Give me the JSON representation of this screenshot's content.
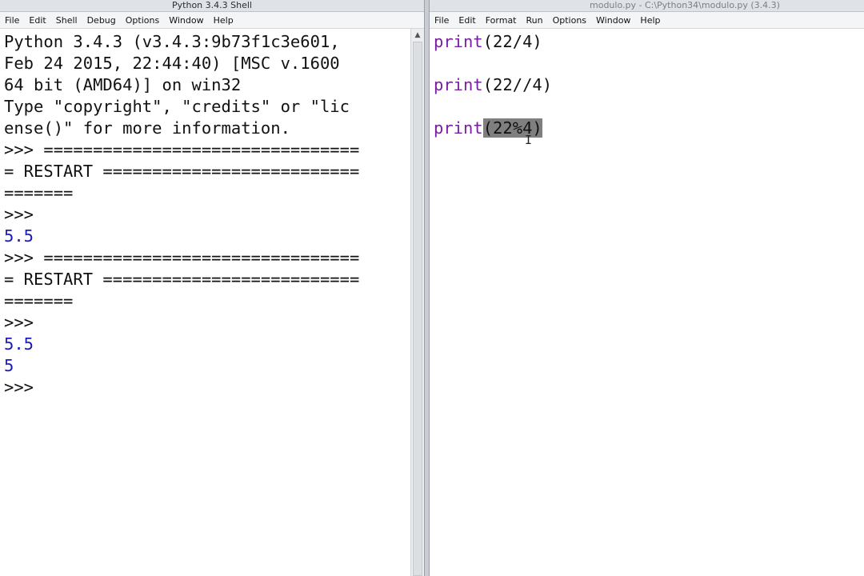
{
  "shell": {
    "title": "Python 3.4.3 Shell",
    "menu": [
      "File",
      "Edit",
      "Shell",
      "Debug",
      "Options",
      "Window",
      "Help"
    ],
    "lines": [
      {
        "text": "Python 3.4.3 (v3.4.3:9b73f1c3e601,",
        "kind": "normal"
      },
      {
        "text": "Feb 24 2015, 22:44:40) [MSC v.1600",
        "kind": "normal"
      },
      {
        "text": "64 bit (AMD64)] on win32",
        "kind": "normal"
      },
      {
        "text": "Type \"copyright\", \"credits\" or \"lic",
        "kind": "normal"
      },
      {
        "text": "ense()\" for more information.",
        "kind": "normal"
      },
      {
        "text": ">>> ================================",
        "kind": "normal"
      },
      {
        "text": "= RESTART ==========================",
        "kind": "normal"
      },
      {
        "text": "=======",
        "kind": "normal"
      },
      {
        "text": ">>>",
        "kind": "normal"
      },
      {
        "text": "5.5",
        "kind": "output"
      },
      {
        "text": ">>> ================================",
        "kind": "normal"
      },
      {
        "text": "= RESTART ==========================",
        "kind": "normal"
      },
      {
        "text": "=======",
        "kind": "normal"
      },
      {
        "text": ">>>",
        "kind": "normal"
      },
      {
        "text": "5.5",
        "kind": "output"
      },
      {
        "text": "5",
        "kind": "output"
      },
      {
        "text": ">>>",
        "kind": "normal"
      }
    ]
  },
  "editor": {
    "title": "modulo.py - C:\\Python34\\modulo.py (3.4.3)",
    "menu": [
      "File",
      "Edit",
      "Format",
      "Run",
      "Options",
      "Window",
      "Help"
    ],
    "lines": [
      {
        "keyword": "print",
        "rest": "(22/4)",
        "selected": ""
      },
      {
        "keyword": "",
        "rest": "",
        "selected": ""
      },
      {
        "keyword": "print",
        "rest": "(22//4)",
        "selected": ""
      },
      {
        "keyword": "",
        "rest": "",
        "selected": ""
      },
      {
        "keyword": "print",
        "rest": "",
        "selected": "(22%4)"
      }
    ]
  },
  "colors": {
    "keyword": "#7a1fa2",
    "output": "#1b1bb8",
    "selection": "#7f7f7f"
  }
}
